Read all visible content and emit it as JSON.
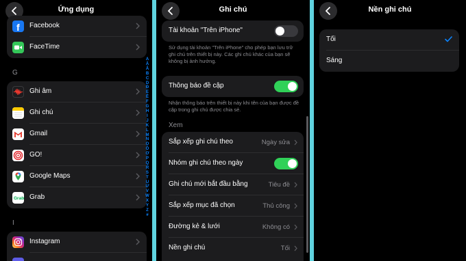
{
  "apps_panel": {
    "title": "Ứng dụng",
    "section_g": "G",
    "section_i": "I",
    "top_apps": [
      {
        "label": "Facebook",
        "icon": "facebook-icon"
      },
      {
        "label": "FaceTime",
        "icon": "facetime-icon"
      }
    ],
    "g_apps": [
      {
        "label": "Ghi âm",
        "icon": "voice-memos-icon"
      },
      {
        "label": "Ghi chú",
        "icon": "notes-icon"
      },
      {
        "label": "Gmail",
        "icon": "gmail-icon"
      },
      {
        "label": "GO!",
        "icon": "go-icon"
      },
      {
        "label": "Google Maps",
        "icon": "google-maps-icon"
      },
      {
        "label": "Grab",
        "icon": "grab-icon"
      }
    ],
    "i_apps": [
      {
        "label": "Instagram",
        "icon": "instagram-icon"
      }
    ],
    "index_letters": [
      "A",
      "Ă",
      "Â",
      "B",
      "C",
      "D",
      "Đ",
      "E",
      "Ê",
      "F",
      "G",
      "H",
      "I",
      "J",
      "K",
      "L",
      "M",
      "N",
      "O",
      "Ô",
      "Ơ",
      "P",
      "Q",
      "R",
      "S",
      "T",
      "U",
      "Ư",
      "V",
      "W",
      "X",
      "Y",
      "Z",
      "#"
    ]
  },
  "notes_panel": {
    "title": "Ghi chú",
    "top_partial_text": "Sử dụng tài khoản 'Trên iPhone'",
    "on_my_iphone_label": "Tài khoản \"Trên iPhone\"",
    "on_my_iphone_toggle": false,
    "on_my_iphone_footnote": "Sử dụng tài khoản \"Trên iPhone\" cho phép bạn lưu trữ ghi chú trên thiết bị này. Các ghi chú khác của bạn sẽ không bị ảnh hưởng.",
    "mention_label": "Thông báo đề cập",
    "mention_toggle": true,
    "mention_footnote": "Nhận thông báo trên thiết bị này khi tên của bạn được đề cập trong ghi chú được chia sẻ.",
    "view_header": "Xem",
    "sort_label": "Sắp xếp ghi chú theo",
    "sort_value": "Ngày sửa",
    "group_label": "Nhóm ghi chú theo ngày",
    "group_toggle": true,
    "new_start_label": "Ghi chú mới bắt đầu bằng",
    "new_start_value": "Tiêu đề",
    "checked_label": "Sắp xếp mục đã chọn",
    "checked_value": "Thủ công",
    "lines_label": "Đường kẻ & lưới",
    "lines_value": "Không có",
    "bg_label": "Nền ghi chú",
    "bg_value": "Tối"
  },
  "background_panel": {
    "title": "Nền ghi chú",
    "options": [
      {
        "label": "Tối",
        "selected": true
      },
      {
        "label": "Sáng",
        "selected": false
      }
    ]
  },
  "colors": {
    "accent": "#0a84ff",
    "toggle_on": "#30d158",
    "cell_bg": "#1c1c1e",
    "divider": "#5fd3df"
  }
}
